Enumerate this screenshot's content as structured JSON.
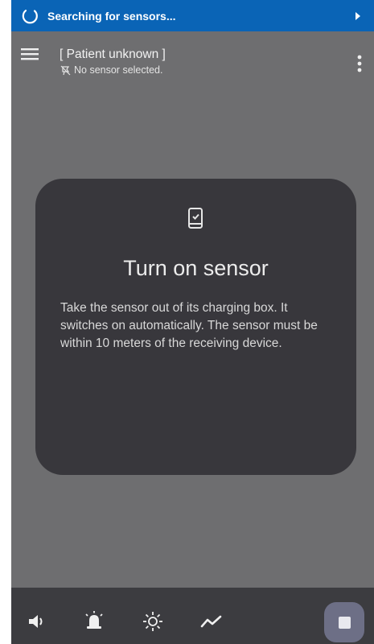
{
  "status_bar": {
    "text": "Searching for sensors...",
    "color": "#0a64b6"
  },
  "header": {
    "patient_name": "[ Patient unknown ]",
    "sensor_status": "No sensor selected."
  },
  "card": {
    "title": "Turn on sensor",
    "body": "Take the sensor out of its charging box. It switches on automatically. The sensor must be within 10 meters of the receiving device."
  },
  "bottom_bar": {
    "icons": [
      "volume-icon",
      "alarm-icon",
      "brightness-icon",
      "trend-icon"
    ],
    "stop_button_icon": "stop-icon"
  },
  "colors": {
    "background": "#6e6e70",
    "card": "#38373c",
    "bottom_bar": "#3c3c40",
    "stop_button": "#6d6f86"
  }
}
